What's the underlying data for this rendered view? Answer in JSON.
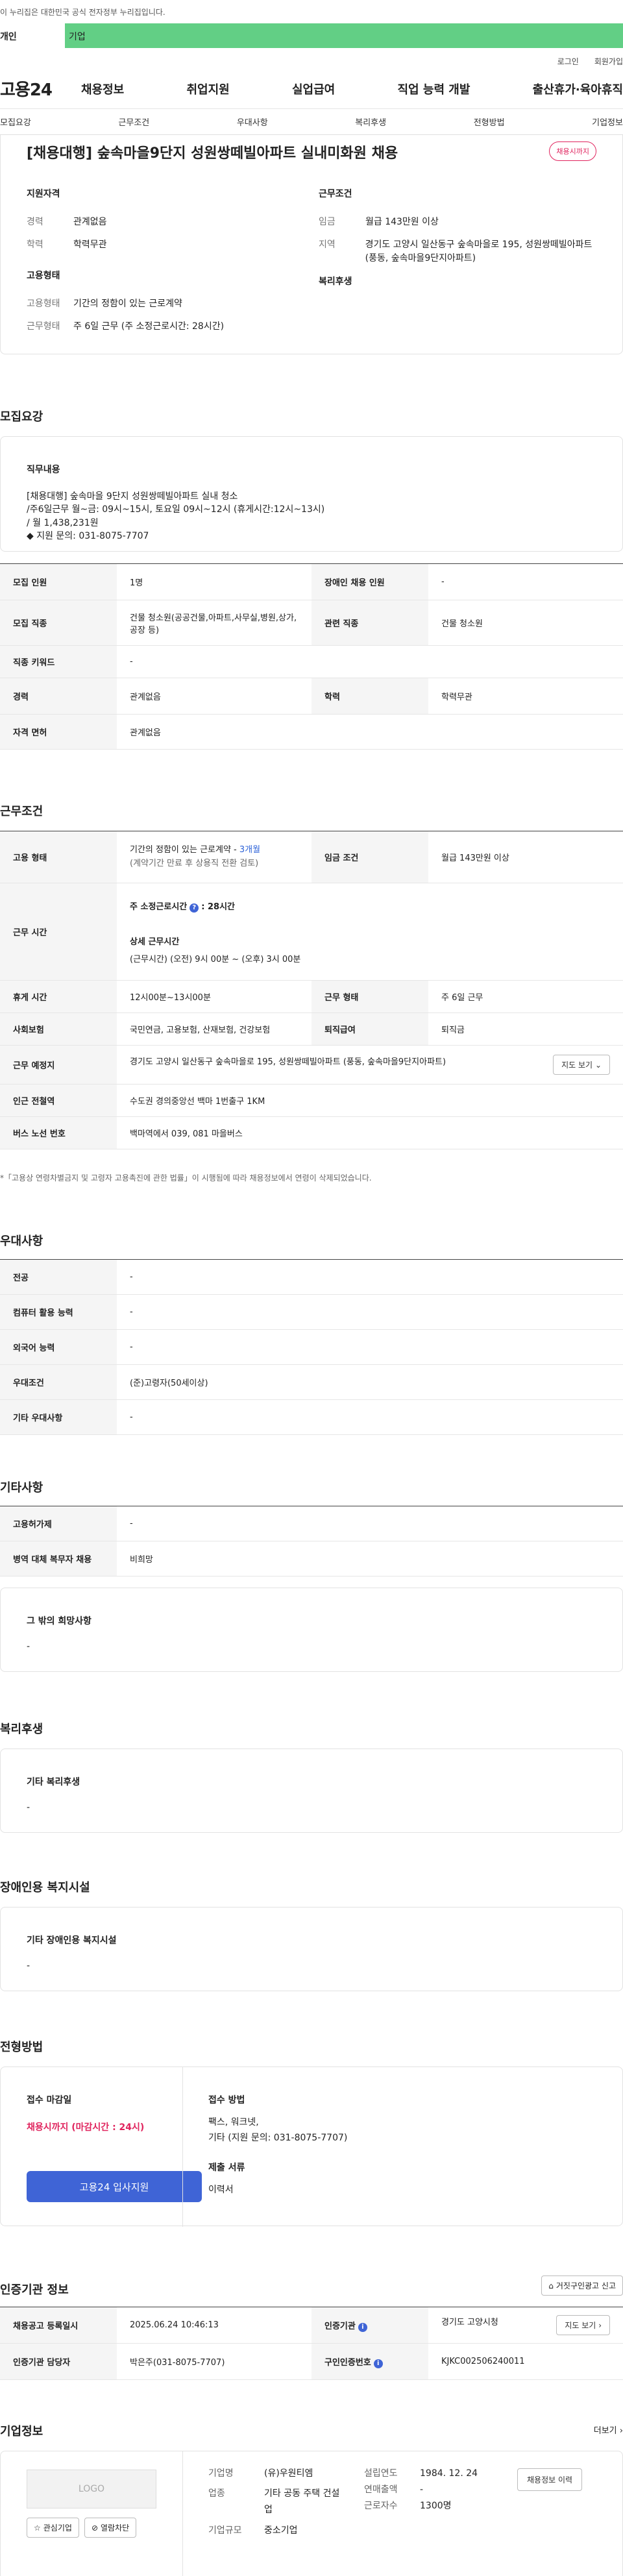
{
  "gov_banner": "이 누리집은 대한민국 공식 전자정부 누리집입니다.",
  "tabs": {
    "person": "개인",
    "company": "기업"
  },
  "util": {
    "login": "로그인",
    "join": "회원가입"
  },
  "logo": "고용24",
  "gnb": [
    "채용정보",
    "취업지원",
    "실업급여",
    "직업 능력 개발",
    "출산휴가·육아휴직"
  ],
  "subnav": [
    "모집요강",
    "근무조건",
    "우대사항",
    "복리후생",
    "전형방법",
    "기업정보"
  ],
  "summary": {
    "title": "[채용대행] 숲속마을9단지 성원쌍떼빌아파트 실내미화원 채용",
    "badge": "채용시까지",
    "qual_heading": "지원자격",
    "qual": [
      {
        "key": "경력",
        "val": "관계없음"
      },
      {
        "key": "학력",
        "val": "학력무관"
      }
    ],
    "cond_heading": "근무조건",
    "cond": [
      {
        "key": "임금",
        "val": "월급 143만원 이상"
      },
      {
        "key": "지역",
        "val": "경기도 고양시 일산동구 숲속마을로 195, 성원쌍떼빌아파트 (풍동, 숲속마을9단지아파트)"
      }
    ],
    "emp_heading": "고용형태",
    "emp": [
      {
        "key": "고용형태",
        "val": "기간의 정함이 있는 근로계약"
      },
      {
        "key": "근무형태",
        "val": "주 6일 근무 (주 소정근로시간: 28시간)"
      }
    ],
    "welfare_heading": "복리후생"
  },
  "recruit": {
    "heading": "모집요강",
    "duty_title": "직무내용",
    "duty_lines": [
      "[채용대행] 숲속마을 9단지 성원쌍떼빌아파트 실내 청소",
      "/주6일근무 월~금: 09시~15시, 토요일 09시~12시 (휴게시간:12시~13시)",
      "/ 월 1,438,231원",
      "◆ 지원 문의:  031-8075-7707"
    ],
    "rows": [
      {
        "k1": "모집 인원",
        "v1": "1명",
        "k2": "장애인 채용 인원",
        "v2": "-"
      },
      {
        "k1": "모집 직종",
        "v1": "건물 청소원(공공건물,아파트,사무실,병원,상가,공장 등)",
        "k2": "관련 직종",
        "v2": "건물 청소원"
      },
      {
        "k1": "직종 키워드",
        "v1": "-"
      },
      {
        "k1": "경력",
        "v1": "관계없음",
        "k2": "학력",
        "v2": "학력무관"
      },
      {
        "k1": "자격 면허",
        "v1": "관계없음"
      }
    ]
  },
  "work": {
    "heading": "근무조건",
    "emp_type_key": "고용 형태",
    "emp_type_val": "기간의 정함이 있는 근로계약 - ",
    "emp_type_months": "3개월",
    "emp_type_note": "(계약기간 만료 후 상용직 전환 검토)",
    "wage_key": "임금 조건",
    "wage_val": "월급 143만원 이상",
    "hours_key": "근무 시간",
    "hours_week_label": "주 소정근로시간",
    "hours_week_val": ": 28시간",
    "hours_detail_label": "상세 근무시간",
    "hours_detail_val": "(근무시간) (오전) 9시 00분 ~ (오후) 3시 00분",
    "break_key": "휴게 시간",
    "break_val": "12시00분~13시00분",
    "worktype_key": "근무 형태",
    "worktype_val": "주 6일 근무",
    "insurance_key": "사회보험",
    "insurance_val": "국민연금, 고용보험, 산재보험, 건강보험",
    "severance_key": "퇴직급여",
    "severance_val": "퇴직금",
    "place_key": "근무 예정지",
    "place_val": "경기도 고양시 일산동구 숲속마을로 195, 성원쌍떼빌아파트 (풍동, 숲속마을9단지아파트)",
    "map_btn": "지도 보기",
    "subway_key": "인근 전철역",
    "subway_val": "수도권 경의중앙선 백마 1번출구 1KM",
    "bus_key": "버스 노선 번호",
    "bus_val": "백마역에서 039, 081 마을버스",
    "note": "*「고용상 연령차별금지 및 고령자 고용촉진에 관한 법률」이 시행됨에 따라 채용정보에서 연령이 삭제되었습니다."
  },
  "pref": {
    "heading": "우대사항",
    "rows": [
      {
        "k": "전공",
        "v": "-"
      },
      {
        "k": "컴퓨터 활용 능력",
        "v": "-"
      },
      {
        "k": "외국어 능력",
        "v": "-"
      },
      {
        "k": "우대조건",
        "v": "(준)고령자(50세이상)"
      },
      {
        "k": "기타 우대사항",
        "v": "-"
      }
    ]
  },
  "etc": {
    "heading": "기타사항",
    "rows": [
      {
        "k": "고용허가제",
        "v": "-"
      },
      {
        "k": "병역 대체 복무자 채용",
        "v": "비희망"
      }
    ],
    "other_title": "그 밖의 희망사항",
    "other_val": "-"
  },
  "welfare": {
    "heading": "복리후생",
    "title": "기타 복리후생",
    "val": "-"
  },
  "disability": {
    "heading": "장애인용 복지시설",
    "title": "기타 장애인용 복지시설",
    "val": "-"
  },
  "selection": {
    "heading": "전형방법",
    "deadline_title": "접수 마감일",
    "deadline_val": "채용시까지 (마감시간 : 24시)",
    "apply_btn": "고용24 입사지원",
    "method_title": "접수 방법",
    "method_lines": [
      "팩스, 워크넷,",
      "기타 (지원 문의:  031-8075-7707)"
    ],
    "docs_title": "제출 서류",
    "docs_val": "이력서"
  },
  "cert": {
    "heading": "인증기관 정보",
    "report_btn": "거짓구인광고 신고",
    "reg_key": "채용공고 등록일시",
    "reg_val": "2025.06.24 10:46:13",
    "org_key": "인증기관",
    "org_val": "경기도 고양시청",
    "org_btn": "지도 보기",
    "staff_key": "인증기관 담당자",
    "staff_val": "박은주(031-8075-7707)",
    "no_key": "구인인증번호",
    "no_val": "KJKC002506240011"
  },
  "company": {
    "heading": "기업정보",
    "more": "더보기",
    "logo": "LOGO",
    "fav_btn": "관심기업",
    "block_btn": "열람차단",
    "name_key": "기업명",
    "name_val": "(유)우원티엠",
    "biz_key": "업종",
    "biz_val": "기타 공동 주택 건설업",
    "size_key": "기업규모",
    "size_val": "중소기업",
    "year_key": "설립연도",
    "year_val": "1984. 12. 24",
    "sales_key": "연매출액",
    "sales_val": "-",
    "emp_key": "근로자수",
    "emp_val": "1300명",
    "history_btn": "채용정보 이력"
  }
}
